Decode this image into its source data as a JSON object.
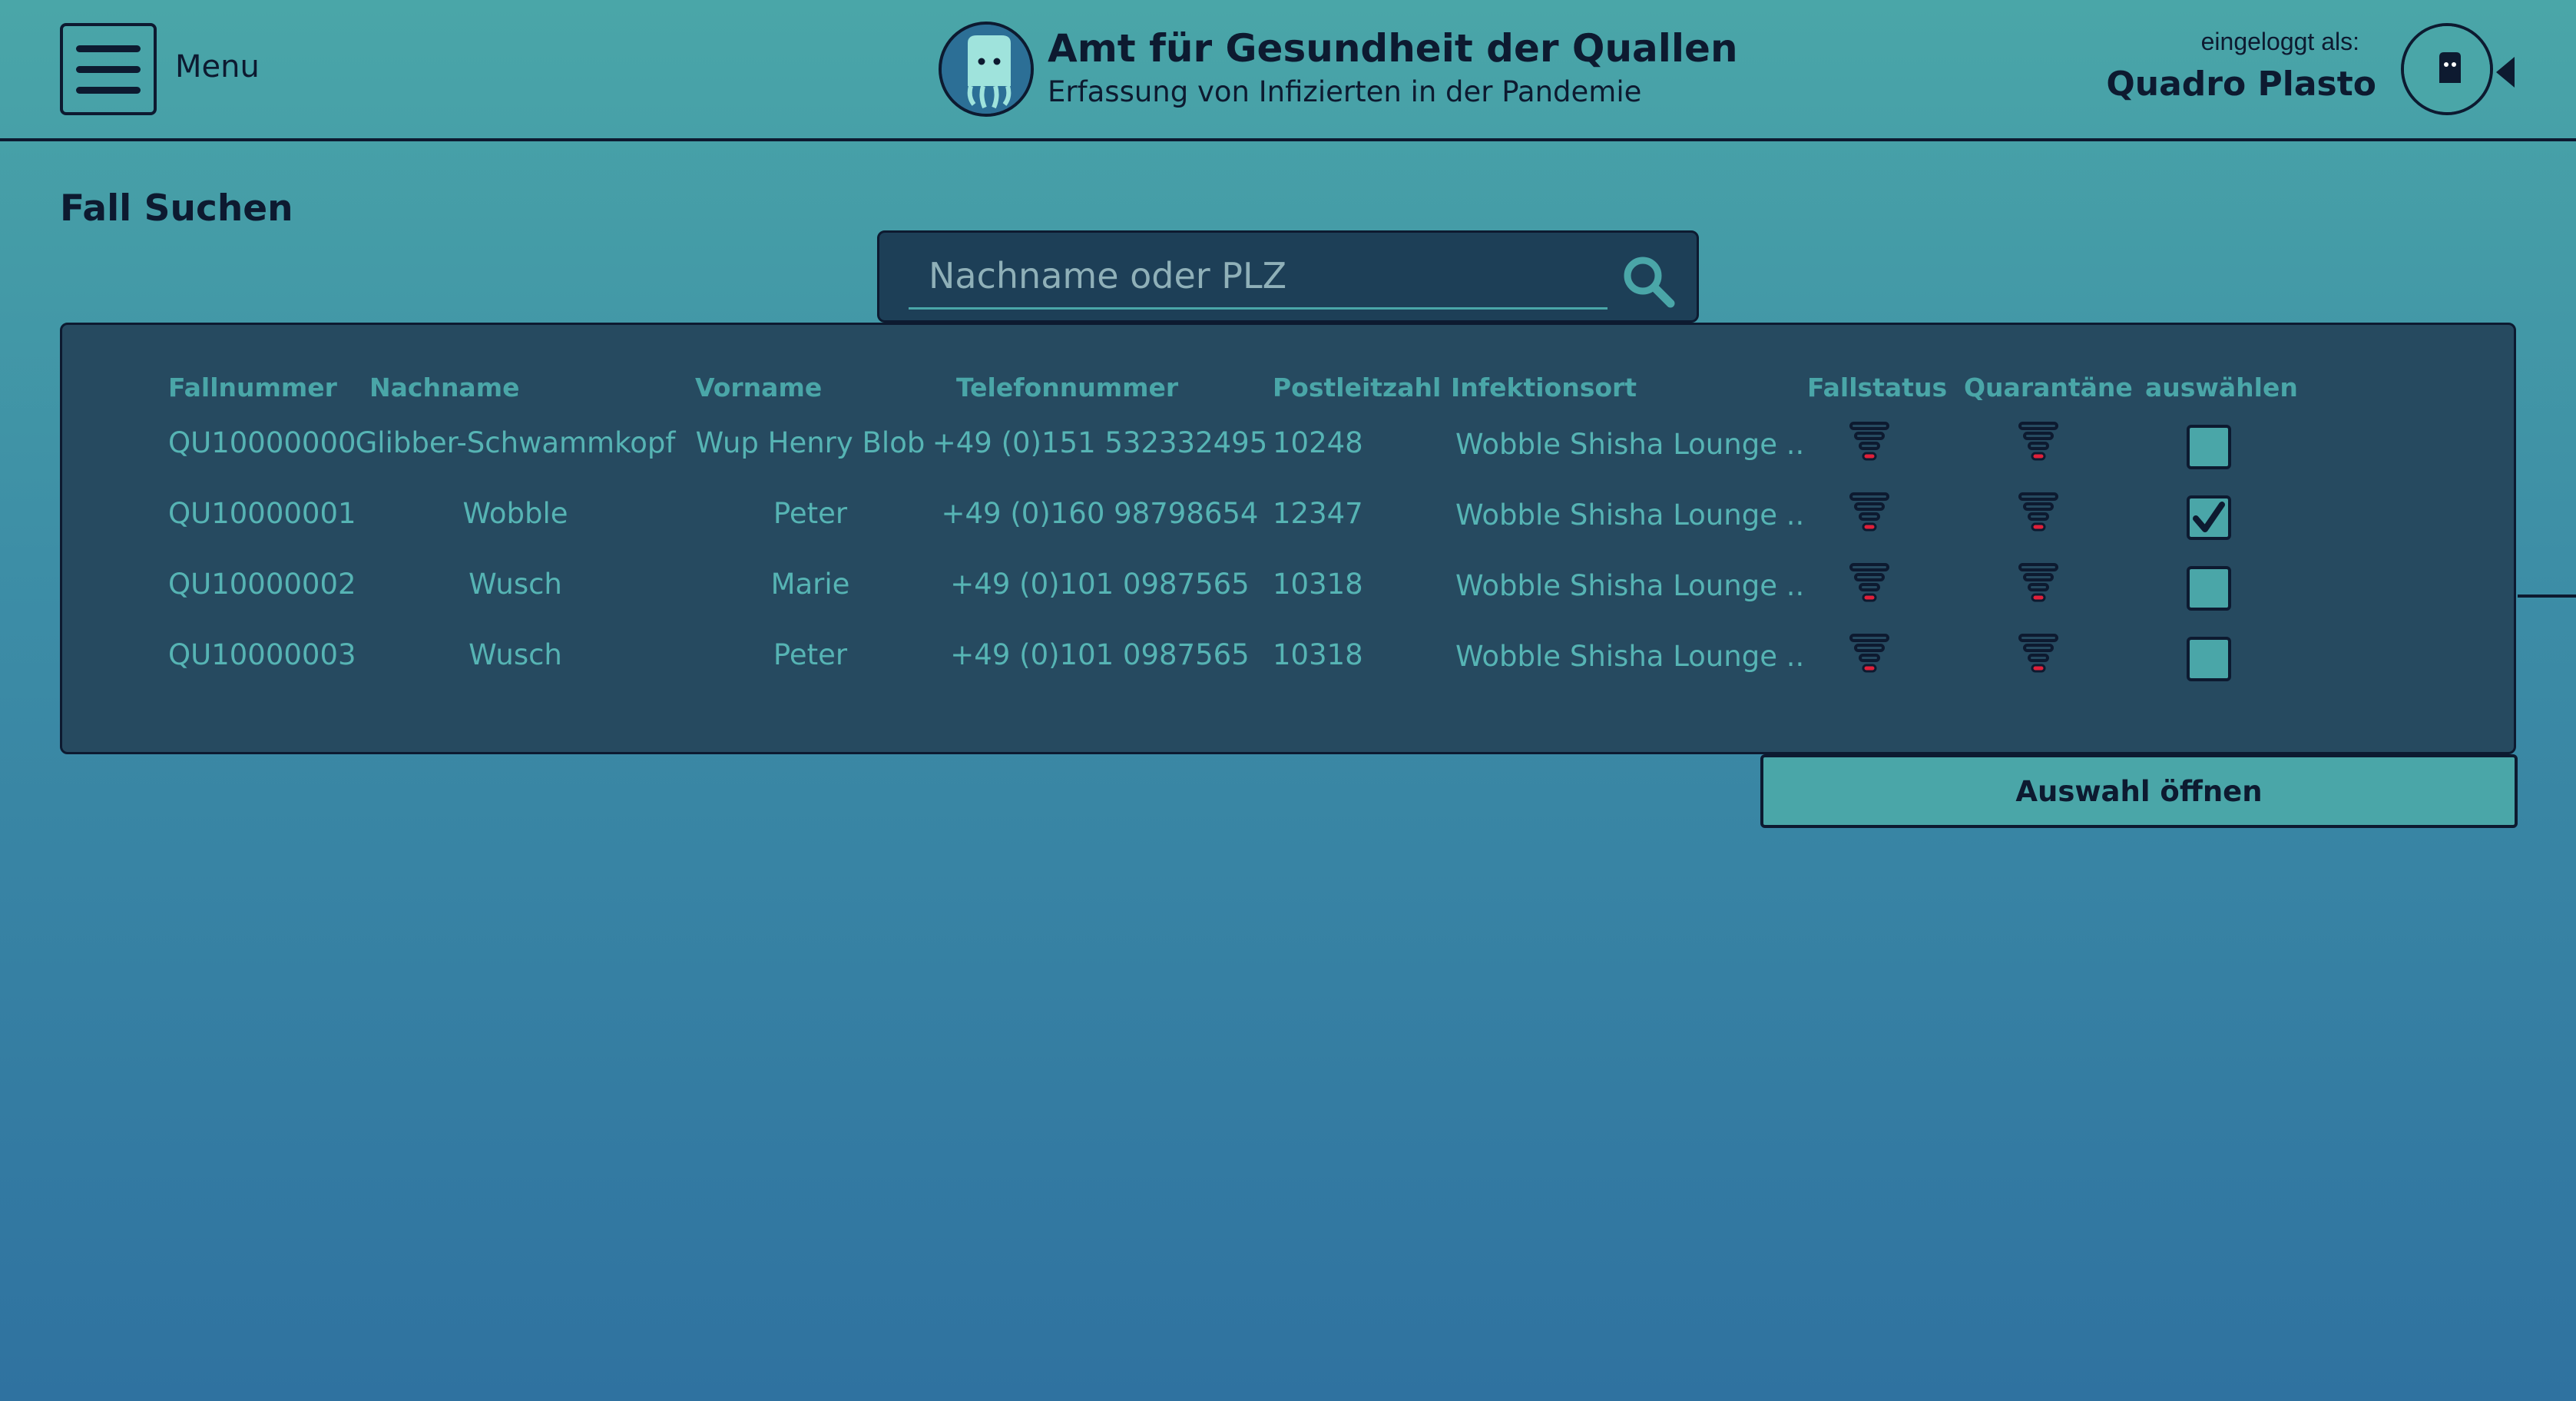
{
  "header": {
    "menu_label": "Menu",
    "title": "Amt für Gesundheit der Quallen",
    "subtitle": "Erfassung von Infizierten in der Pandemie",
    "login_label": "eingeloggt als:",
    "user_name": "Quadro Plasto"
  },
  "page": {
    "title": "Fall Suchen"
  },
  "search": {
    "placeholder": "Nachname oder PLZ",
    "value": ""
  },
  "table": {
    "columns": [
      "Fallnummer",
      "Nachname",
      "Vorname",
      "Telefonnummer",
      "Postleitzahl",
      "Infektionsort",
      "Fallstatus",
      "Quarantäne",
      "auswählen"
    ],
    "rows": [
      {
        "fallnummer": "QU10000000",
        "nachname": "Glibber-Schwammkopf",
        "vorname": "Wup Henry Blob",
        "telefon": "+49 (0)151 532332495",
        "plz": "10248",
        "ort": "Wobble Shisha Lounge ..",
        "fallstatus_icon": "status-level-icon",
        "quarantaene_icon": "status-level-icon",
        "selected": false
      },
      {
        "fallnummer": "QU10000001",
        "nachname": "Wobble",
        "vorname": "Peter",
        "telefon": "+49 (0)160 98798654",
        "plz": "12347",
        "ort": "Wobble Shisha Lounge ..",
        "fallstatus_icon": "status-level-icon",
        "quarantaene_icon": "status-level-icon",
        "selected": true
      },
      {
        "fallnummer": "QU10000002",
        "nachname": "Wusch",
        "vorname": "Marie",
        "telefon": "+49 (0)101 0987565",
        "plz": "10318",
        "ort": "Wobble Shisha Lounge ..",
        "fallstatus_icon": "status-level-icon",
        "quarantaene_icon": "status-level-icon",
        "selected": false
      },
      {
        "fallnummer": "QU10000003",
        "nachname": "Wusch",
        "vorname": "Peter",
        "telefon": "+49 (0)101 0987565",
        "plz": "10318",
        "ort": "Wobble Shisha Lounge ..",
        "fallstatus_icon": "status-level-icon",
        "quarantaene_icon": "status-level-icon",
        "selected": false
      }
    ]
  },
  "actions": {
    "open_selection": "Auswahl öffnen"
  },
  "colors": {
    "accent": "#4aa6a8",
    "panel": "#264a60",
    "dark": "#0d1a30",
    "status_red": "#e0203a"
  },
  "icons": [
    "menu-icon",
    "jellyfish-logo",
    "user-avatar-icon",
    "caret-left-icon",
    "search-icon",
    "status-level-icon",
    "checkmark-icon"
  ]
}
